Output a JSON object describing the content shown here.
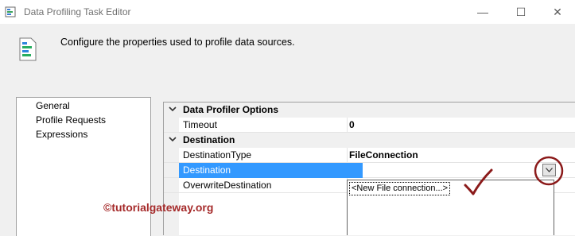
{
  "window": {
    "title": "Data Profiling Task Editor",
    "minimize_glyph": "—",
    "maximize_glyph": "☐",
    "close_glyph": "✕"
  },
  "header": {
    "description": "Configure the properties used to profile data sources."
  },
  "nav": {
    "items": [
      {
        "label": "General",
        "selected": true
      },
      {
        "label": "Profile Requests",
        "selected": false
      },
      {
        "label": "Expressions",
        "selected": false
      }
    ]
  },
  "grid": {
    "categories": [
      {
        "label": "Data Profiler Options"
      },
      {
        "label": "Destination"
      }
    ],
    "properties": [
      {
        "label": "Timeout",
        "value": "0"
      },
      {
        "label": "DestinationType",
        "value": "FileConnection"
      },
      {
        "label": "Destination",
        "value": ""
      },
      {
        "label": "OverwriteDestination",
        "value": ""
      }
    ]
  },
  "dropdown": {
    "options": [
      "<New File connection...>"
    ]
  },
  "watermark": {
    "text": "©tutorialgateway.org"
  },
  "colors": {
    "selection": "#3399ff",
    "annotation": "#8b1a1a",
    "watermark": "#a52a2a"
  }
}
